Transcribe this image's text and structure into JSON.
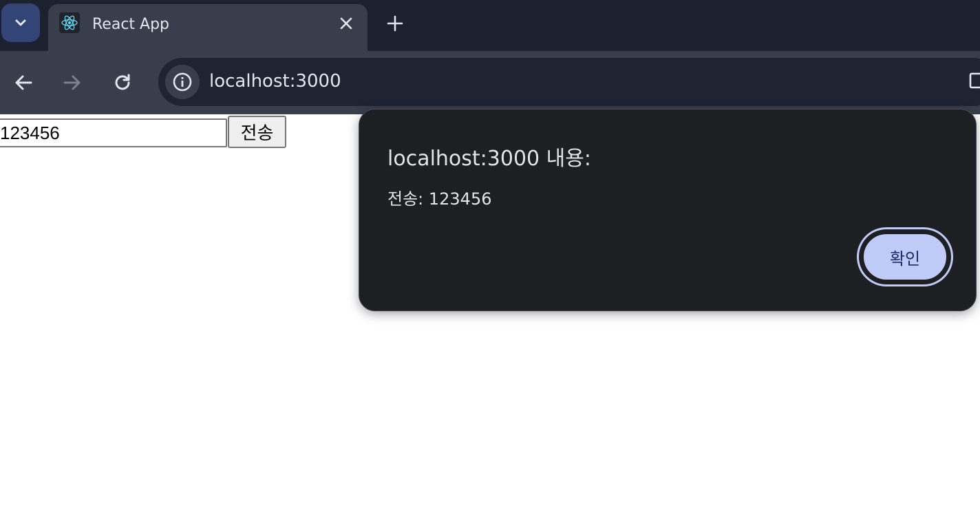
{
  "browser": {
    "tab": {
      "title": "React App",
      "favicon": "react-logo-icon"
    },
    "address_bar": {
      "url": "localhost:3000"
    },
    "colors": {
      "tabstrip": "#1c2130",
      "toolbar": "#393e4d",
      "omnibox": "#1f2433"
    }
  },
  "page": {
    "input_value": "123456",
    "submit_label": "전송"
  },
  "dialog": {
    "title": "localhost:3000 내용:",
    "message": "전송: 123456",
    "ok_label": "확인",
    "colors": {
      "background": "#1e1f23",
      "button": "#c1cbf7",
      "button_text": "#1b2a6b"
    }
  }
}
